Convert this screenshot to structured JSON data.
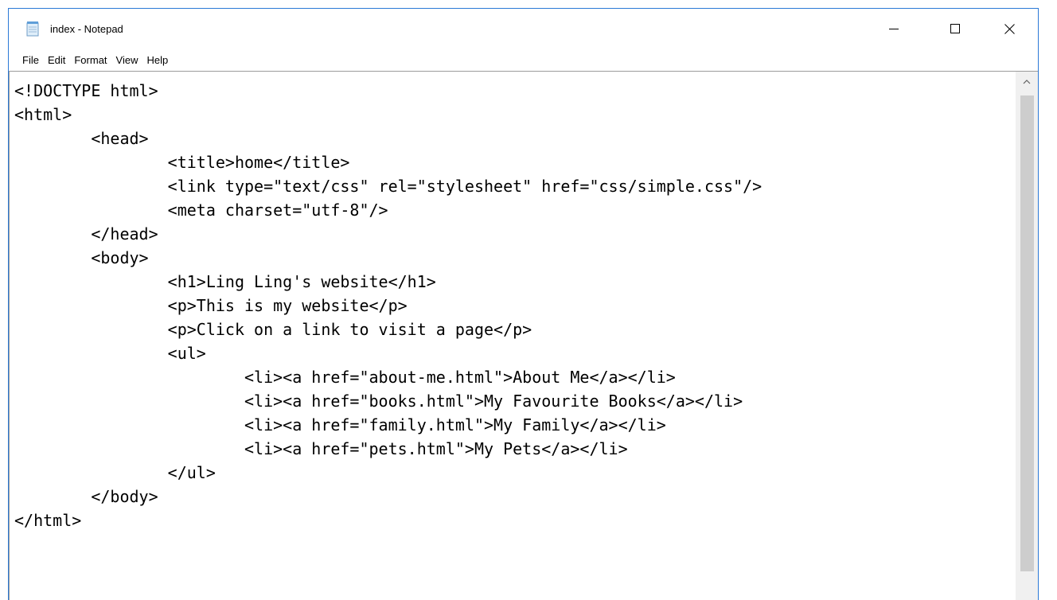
{
  "window": {
    "title": "index - Notepad"
  },
  "icons": {
    "app": "notepad-icon",
    "minimize": "minimize-icon",
    "maximize": "maximize-icon",
    "close": "close-icon",
    "scroll_up": "chevron-up-icon"
  },
  "colors": {
    "window_border": "#2b79d7",
    "scrollbar_track": "#f0f0f0",
    "scrollbar_thumb": "#cdcdcd"
  },
  "menu": {
    "file": "File",
    "edit": "Edit",
    "format": "Format",
    "view": "View",
    "help": "Help"
  },
  "editor": {
    "lines": [
      "<!DOCTYPE html>",
      "<html>",
      "        <head>",
      "                <title>home</title>",
      "                <link type=\"text/css\" rel=\"stylesheet\" href=\"css/simple.css\"/>",
      "                <meta charset=\"utf-8\"/>",
      "        </head>",
      "        <body>",
      "                <h1>Ling Ling's website</h1>",
      "                <p>This is my website</p>",
      "                <p>Click on a link to visit a page</p>",
      "                <ul>",
      "                        <li><a href=\"about-me.html\">About Me</a></li>",
      "                        <li><a href=\"books.html\">My Favourite Books</a></li>",
      "                        <li><a href=\"family.html\">My Family</a></li>",
      "                        <li><a href=\"pets.html\">My Pets</a></li>",
      "                </ul>",
      "        </body>",
      "</html>"
    ]
  }
}
